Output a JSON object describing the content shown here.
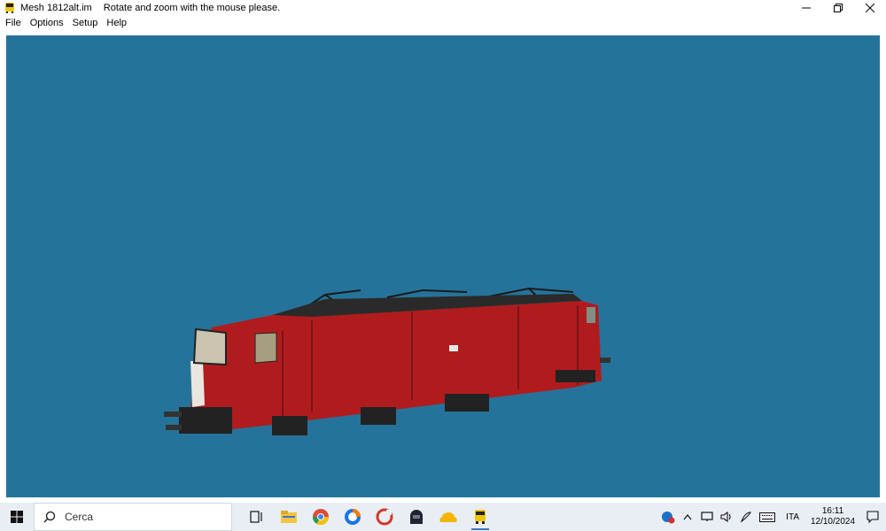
{
  "window": {
    "title": "Mesh 1812alt.im",
    "hint": "Rotate and zoom with the mouse please.",
    "controls": {
      "minimize": "minimize-icon",
      "restore": "restore-icon",
      "close": "close-icon"
    }
  },
  "menu": {
    "items": [
      {
        "label": "File"
      },
      {
        "label": "Options"
      },
      {
        "label": "Setup"
      },
      {
        "label": "Help"
      }
    ]
  },
  "viewport": {
    "background": "#25739a",
    "model": {
      "body_color": "#b01c1e",
      "roof_color": "#2a2a2a"
    }
  },
  "taskbar": {
    "search": {
      "placeholder": "Cerca"
    },
    "language": "ITA",
    "time": "16:11",
    "date": "12/10/2024"
  },
  "colors": {
    "taskbar_bg": "#e9eef4",
    "accent": "#3b78c4"
  }
}
